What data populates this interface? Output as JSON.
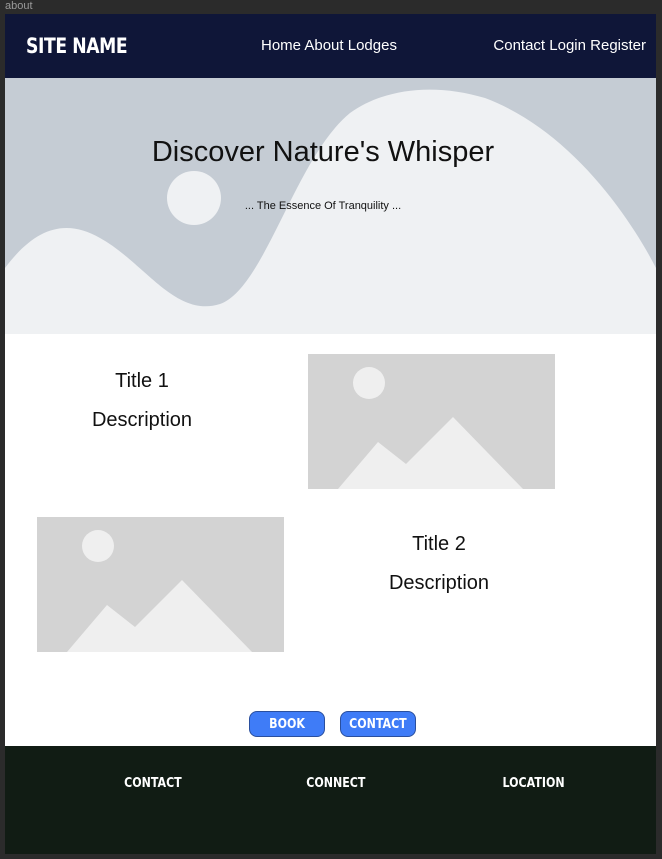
{
  "frame": {
    "label": "about"
  },
  "nav": {
    "site_name": "SITE NAME",
    "left_links": [
      "Home",
      "About",
      "Lodges"
    ],
    "right_links": [
      "Contact",
      "Login",
      "Register"
    ]
  },
  "hero": {
    "title": "Discover Nature's Whisper",
    "subtitle": "... The Essence Of Tranquility ..."
  },
  "features": [
    {
      "title": "Title 1",
      "description": "Description"
    },
    {
      "title": "Title 2",
      "description": "Description"
    }
  ],
  "buttons": {
    "book": "BOOK",
    "contact": "CONTACT"
  },
  "footer": {
    "contact": "CONTACT",
    "connect": "CONNECT",
    "location": "LOCATION"
  },
  "colors": {
    "nav_bg": "#0f1638",
    "hero_bg": "#c5ccd4",
    "button_bg": "#3f7cf7",
    "footer_bg": "#111c14"
  }
}
